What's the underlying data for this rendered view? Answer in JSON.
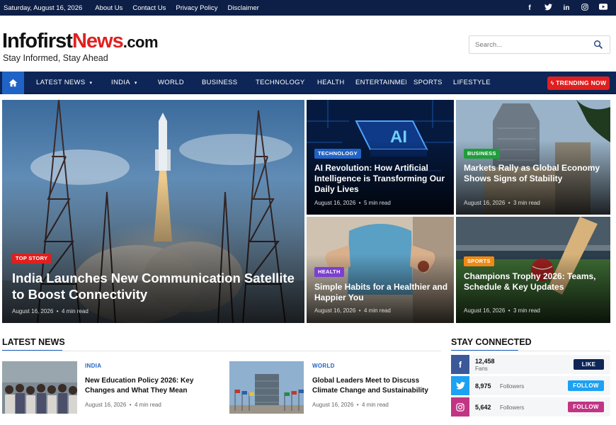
{
  "topbar": {
    "date": "Saturday, August 16, 2026",
    "links": [
      "About Us",
      "Contact Us",
      "Privacy Policy",
      "Disclaimer"
    ],
    "socials": [
      "facebook-icon",
      "twitter-icon",
      "linkedin-icon",
      "instagram-icon",
      "youtube-icon"
    ]
  },
  "header": {
    "logo_part1": "Infofirst",
    "logo_part2": "News",
    "logo_part3": ".com",
    "tagline": "Stay Informed, Stay Ahead",
    "search_placeholder": "Search..."
  },
  "nav": {
    "items": [
      "LATEST NEWS",
      "INDIA",
      "WORLD",
      "BUSINESS",
      "TECHNOLOGY",
      "HEALTH",
      "ENTERTAINMENT",
      "SPORTS",
      "LIFESTYLE"
    ],
    "trending": "TRENDING NOW"
  },
  "hero": {
    "main": {
      "badge": "TOP STORY",
      "title": "India Launches New Communication Satellite to Boost Connectivity",
      "date": "August 16, 2026",
      "read": "4 min read"
    },
    "cards": [
      {
        "badge": "TECHNOLOGY",
        "title": "AI Revolution: How Artificial Intelligence is Transforming Our Daily Lives",
        "date": "August 16, 2026",
        "read": "5 min read",
        "color": "#1f63c6"
      },
      {
        "badge": "BUSINESS",
        "title": "Markets Rally as Global Economy Shows Signs of Stability",
        "date": "August 16, 2026",
        "read": "3 min read",
        "color": "#1e9e3a"
      },
      {
        "badge": "HEALTH",
        "title": "Simple Habits for a Healthier and Happier You",
        "date": "August 16, 2026",
        "read": "4 min read",
        "color": "#7b3fd1"
      },
      {
        "badge": "SPORTS",
        "title": "Champions Trophy 2026: Teams, Schedule & Key Updates",
        "date": "August 16, 2026",
        "read": "3 min read",
        "color": "#f08a16"
      }
    ],
    "ai_text": "AI"
  },
  "latest": {
    "heading": "LATEST NEWS",
    "items": [
      {
        "category": "INDIA",
        "title": "New Education Policy 2026: Key Changes and What They Mean",
        "date": "August 16, 2026",
        "read": "4 min read"
      },
      {
        "category": "WORLD",
        "title": "Global Leaders Meet to Discuss Climate Change and Sustainability",
        "date": "August 16, 2026",
        "read": "4 min read"
      }
    ]
  },
  "social": {
    "heading": "STAY CONNECTED",
    "rows": [
      {
        "icon": "facebook-icon",
        "glyph": "f",
        "count": "12,458",
        "label": "Fans",
        "button": "LIKE",
        "color": "#3b5998",
        "btn_color": "#0d2657"
      },
      {
        "icon": "twitter-icon",
        "glyph": "t",
        "count": "8,975",
        "label": "Followers",
        "button": "FOLLOW",
        "color": "#1da1f2",
        "btn_color": "#1da1f2"
      },
      {
        "icon": "instagram-icon",
        "glyph": "◎",
        "count": "5,642",
        "label": "Followers",
        "button": "FOLLOW",
        "color": "#c13584",
        "btn_color": "#c13584"
      }
    ]
  },
  "separator": "•"
}
